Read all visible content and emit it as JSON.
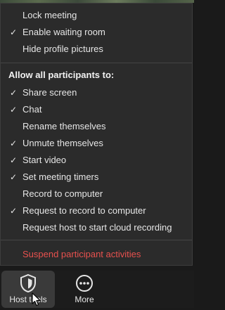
{
  "menu": {
    "top_items": [
      {
        "label": "Lock meeting",
        "checked": false
      },
      {
        "label": "Enable waiting room",
        "checked": true
      },
      {
        "label": "Hide profile pictures",
        "checked": false
      }
    ],
    "section_title": "Allow all participants to:",
    "participant_items": [
      {
        "label": "Share screen",
        "checked": true
      },
      {
        "label": "Chat",
        "checked": true
      },
      {
        "label": "Rename themselves",
        "checked": false
      },
      {
        "label": "Unmute themselves",
        "checked": true
      },
      {
        "label": "Start video",
        "checked": true
      },
      {
        "label": "Set meeting timers",
        "checked": true
      },
      {
        "label": "Record to computer",
        "checked": false
      },
      {
        "label": "Request to record to computer",
        "checked": true
      },
      {
        "label": "Request host to start cloud recording",
        "checked": false
      }
    ],
    "danger_item": "Suspend participant activities",
    "check_glyph": "✓"
  },
  "toolbar": {
    "host_tools_label": "Host tools",
    "more_label": "More"
  },
  "colors": {
    "danger": "#e8514e",
    "menu_bg": "#2b2b2b",
    "toolbar_bg": "#1c1c1c"
  },
  "icons": {
    "host_tools": "shield-icon",
    "more": "more-dots-icon",
    "cursor": "mouse-cursor-icon"
  }
}
